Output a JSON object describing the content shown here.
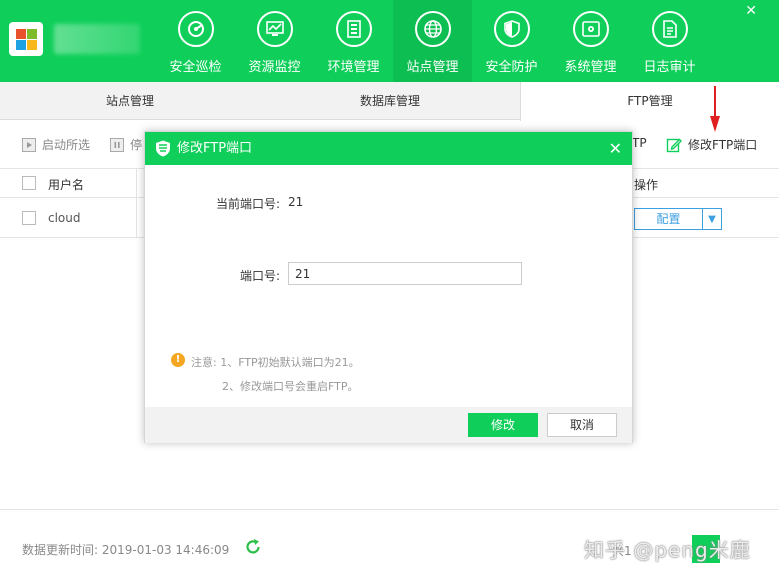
{
  "header": {
    "nav": [
      {
        "label": "安全巡检",
        "icon": "radar-icon",
        "active": false
      },
      {
        "label": "资源监控",
        "icon": "monitor-icon",
        "active": false
      },
      {
        "label": "环境管理",
        "icon": "server-icon",
        "active": false
      },
      {
        "label": "站点管理",
        "icon": "globe-icon",
        "active": true
      },
      {
        "label": "安全防护",
        "icon": "shield-icon",
        "active": false
      },
      {
        "label": "系统管理",
        "icon": "system-icon",
        "active": false
      },
      {
        "label": "日志审计",
        "icon": "log-icon",
        "active": false
      }
    ],
    "close_glyph": "✕"
  },
  "subtabs": [
    {
      "label": "站点管理",
      "active": false
    },
    {
      "label": "数据库管理",
      "active": false
    },
    {
      "label": "FTP管理",
      "active": true
    }
  ],
  "toolbar": {
    "start_selected": "启动所选",
    "stop_partial": "停",
    "ftp_partial": "TP",
    "modify_port": "修改FTP端口"
  },
  "table": {
    "headers": {
      "username": "用户名",
      "actions": "操作"
    },
    "rows": [
      {
        "username": "cloud",
        "action": "配置"
      }
    ]
  },
  "footer": {
    "update_time": "数据更新时间: 2019-01-03 14:46:09",
    "pager_partial": "共1",
    "watermark": "知乎 @peng米鹿"
  },
  "modal": {
    "title": "修改FTP端口",
    "close_glyph": "✕",
    "current_port_label": "当前端口号:",
    "current_port_value": "21",
    "port_label": "端口号:",
    "port_value": "21",
    "note_line1": "注意: 1、FTP初始默认端口为21。",
    "note_line2": "2、修改端口号会重启FTP。",
    "ok_label": "修改",
    "cancel_label": "取消"
  },
  "colors": {
    "brand_green": "#0fcf5a",
    "link_blue": "#3c9fe0",
    "warning_orange": "#f5a623",
    "arrow_red": "#e02020"
  }
}
